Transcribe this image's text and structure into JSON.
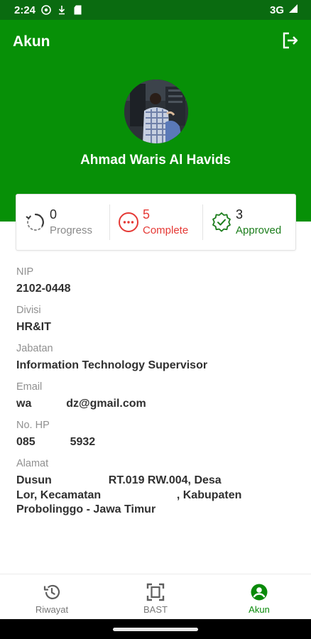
{
  "status_bar": {
    "time": "2:24",
    "network": "3G",
    "icons": [
      "chrome-icon",
      "download-icon",
      "sim-card-icon",
      "signal-icon"
    ]
  },
  "header": {
    "title": "Akun",
    "logout_icon": "logout-icon",
    "user_name": "Ahmad Waris Al Havids",
    "background_color": "#079007"
  },
  "stats": [
    {
      "count": "0",
      "label": "Progress",
      "icon": "refresh-icon",
      "color": "#8a8a8a"
    },
    {
      "count": "5",
      "label": "Complete",
      "icon": "more-horizontal-circle-icon",
      "color": "#e53935"
    },
    {
      "count": "3",
      "label": "Approved",
      "icon": "verified-badge-icon",
      "color": "#1b7d1b"
    }
  ],
  "profile": {
    "nip_label": "NIP",
    "nip_value": "2102-0448",
    "divisi_label": "Divisi",
    "divisi_value": "HR&IT",
    "jabatan_label": "Jabatan",
    "jabatan_value": "Information Technology Supervisor",
    "email_label": "Email",
    "email_value": "wa           dz@gmail.com",
    "hp_label": "No. HP",
    "hp_value": "085           5932",
    "alamat_label": "Alamat",
    "alamat_line1": "Dusun                  RT.019 RW.004, Desa",
    "alamat_line2": "Lor, Kecamatan                        , Kabupaten",
    "alamat_line3": "Probolinggo - Jawa Timur"
  },
  "bottom_nav": [
    {
      "label": "Riwayat",
      "icon": "history-icon",
      "active": false
    },
    {
      "label": "BAST",
      "icon": "document-scan-icon",
      "active": false
    },
    {
      "label": "Akun",
      "icon": "account-circle-icon",
      "active": true
    }
  ],
  "colors": {
    "primary": "#079007",
    "status_bar": "#0a6b10",
    "complete": "#e53935",
    "approved": "#1b7d1b"
  }
}
